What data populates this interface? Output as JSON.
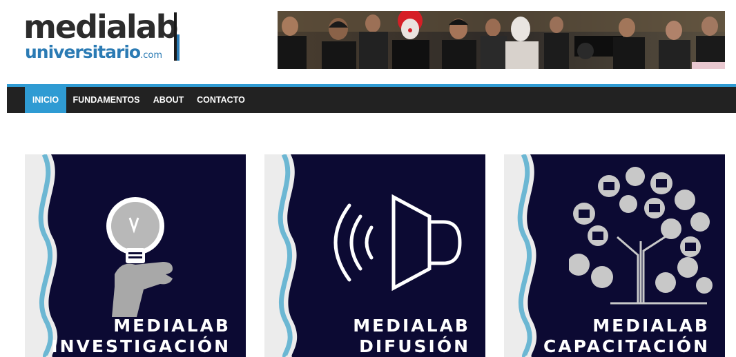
{
  "logo": {
    "top": "medialab",
    "bottom": "universitario",
    "suffix": ".com"
  },
  "nav": {
    "items": [
      "INICIO",
      "FUNDAMENTOS",
      "ABOUT",
      "CONTACTO"
    ],
    "active": "INICIO"
  },
  "cards": [
    {
      "title_line1": "MEDIALAB",
      "title_line2": "INVESTIGACIÓN",
      "icon": "lightbulb-hand-icon"
    },
    {
      "title_line1": "MEDIALAB",
      "title_line2": "DIFUSIÓN",
      "icon": "speaker-icon"
    },
    {
      "title_line1": "MEDIALAB",
      "title_line2": "CAPACITACIÓN",
      "icon": "media-tree-icon"
    }
  ],
  "colors": {
    "nav_bg": "#222222",
    "accent": "#2f9bd3",
    "card_bg": "#0c0a33",
    "wave": "#6cb7d3",
    "logo_blue": "#2b7bb4"
  }
}
